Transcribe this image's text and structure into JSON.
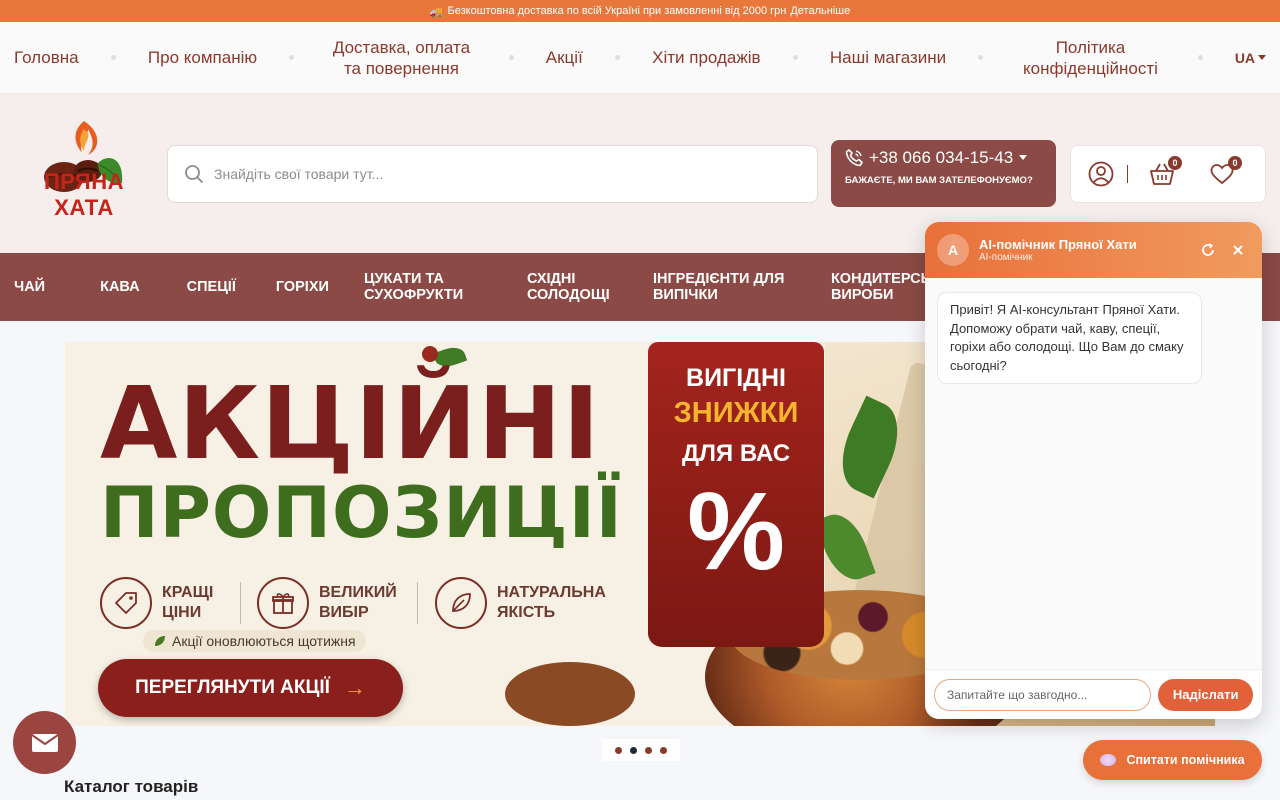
{
  "promo": {
    "text": "Безкоштовна доставка по всій Україні при замовленні від 2000 грн",
    "link": "Детальніше"
  },
  "topnav": {
    "items": [
      "Головна",
      "Про компанію",
      "Доставка, оплата та повернення",
      "Акції",
      "Хіти продажів",
      "Наші магазини",
      "Політика конфіденційності"
    ],
    "lang": "UA"
  },
  "header": {
    "logo_text": "ПРЯНА ХАТА",
    "search_placeholder": "Знайдіть свої товари тут...",
    "phone": "+38 066 034-15-43",
    "callback": "Бажаєте, ми вам зателефонуємо?",
    "cart_count": "0",
    "wishlist_count": "0"
  },
  "categories": [
    "Чай",
    "Кава",
    "Спеції",
    "Горіхи",
    "Цукати та сухофрукти",
    "Східні солодощі",
    "Інгредієнти для випічки",
    "Кондитерські вироби"
  ],
  "banner": {
    "title1": "АКЦІЙНІ",
    "title2": "ПРОПОЗИЦІЇ",
    "tag_line1": "ВИГІДНІ",
    "tag_line2": "ЗНИЖКИ",
    "tag_line3": "ДЛЯ ВАС",
    "tag_symbol": "%",
    "features": [
      "КРАЩІ ЦІНИ",
      "ВЕЛИКИЙ ВИБІР",
      "НАТУРАЛЬНА ЯКІСТЬ"
    ],
    "weekly": "Акції оновлюються щотижня",
    "cta": "ПЕРЕГЛЯНУТИ АКЦІЇ"
  },
  "catalog_title": "Каталог товарів",
  "chat": {
    "avatar_letter": "A",
    "title": "AI-помічник Пряної Хати",
    "subtitle": "AI-помічник",
    "message": "Привіт! Я AI-консультант Пряної Хати. Допоможу обрати чай, каву, спеції, горіхи або солодощі. Що Вам до смаку сьогодні?",
    "input_placeholder": "Запитайте що завгодно...",
    "send_label": "Надіслати"
  },
  "ask_button": "Спитати помічника",
  "colors": {
    "accent_orange": "#e8773c",
    "brand_brown": "#8b4a45",
    "text_brown": "#8a3a2d"
  },
  "icons": [
    "truck-icon",
    "search-icon",
    "phone-icon",
    "user-icon",
    "cart-icon",
    "heart-icon",
    "mail-icon",
    "refresh-icon",
    "close-icon"
  ]
}
